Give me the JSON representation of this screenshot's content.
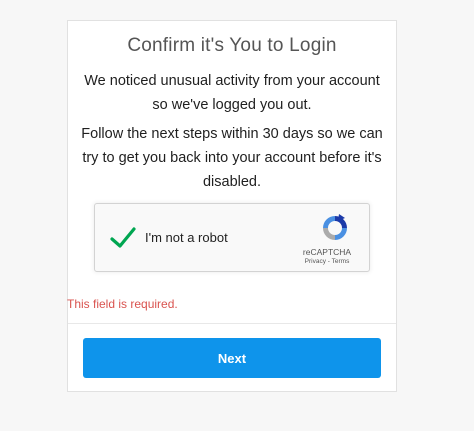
{
  "dialog": {
    "title": "Confirm it's You to Login",
    "message_1": "We noticed unusual activity from your account so we've logged you out.",
    "message_2": "Follow the next steps within 30 days so we can try to get you back into your account before it's disabled."
  },
  "recaptcha": {
    "label": "I'm not a robot",
    "checked": true,
    "brand": "reCAPTCHA",
    "links": "Privacy - Terms",
    "check_icon": "checkmark-icon",
    "logo_icon": "recaptcha-logo-icon"
  },
  "validation": {
    "error": "This field is required."
  },
  "actions": {
    "next_label": "Next"
  },
  "colors": {
    "primary": "#0e94eb",
    "check": "#00a651",
    "error": "#d9534f"
  }
}
